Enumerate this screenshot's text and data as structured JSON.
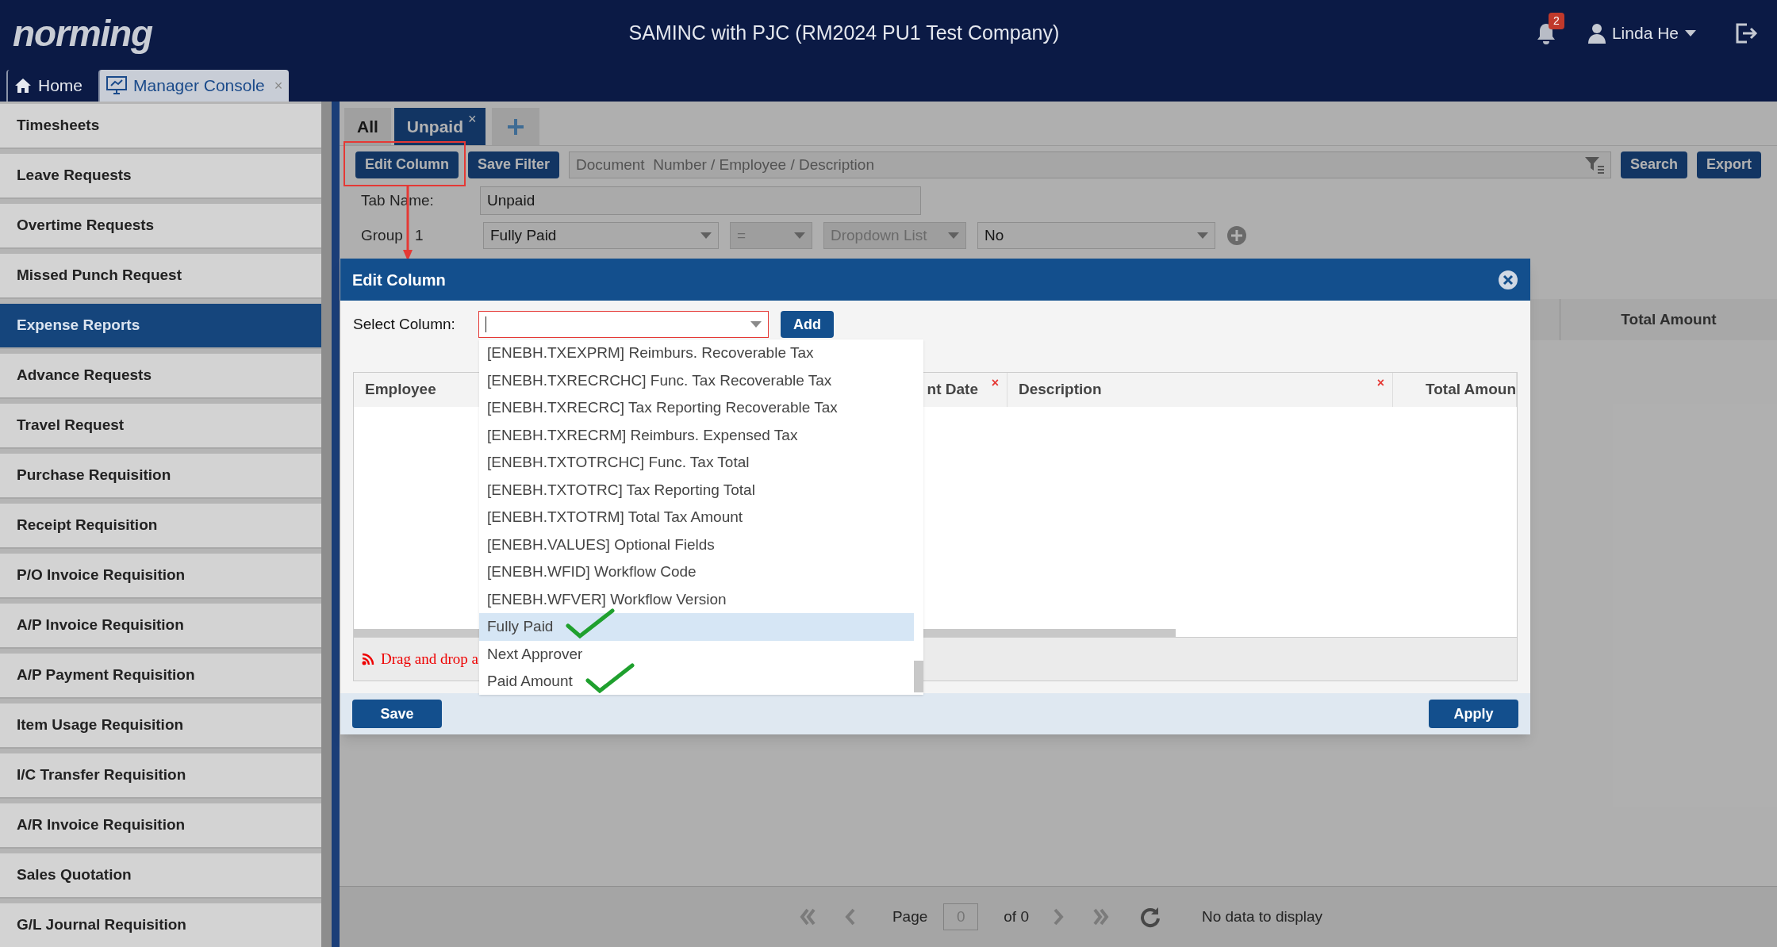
{
  "header": {
    "logo": "norming",
    "title": "SAMINC with PJC (RM2024 PU1 Test Company)",
    "notification_count": "2",
    "user": "Linda He"
  },
  "nav_tabs": [
    {
      "label": "Home",
      "selected": false
    },
    {
      "label": "Manager Console",
      "selected": true,
      "close": "×"
    }
  ],
  "sidebar": {
    "items": [
      {
        "label": "Timesheets",
        "selected": false
      },
      {
        "label": "Leave Requests",
        "selected": false
      },
      {
        "label": "Overtime Requests",
        "selected": false
      },
      {
        "label": "Missed Punch Request",
        "selected": false
      },
      {
        "label": "Expense Reports",
        "selected": true
      },
      {
        "label": "Advance Requests",
        "selected": false
      },
      {
        "label": "Travel Request",
        "selected": false
      },
      {
        "label": "Purchase Requisition",
        "selected": false
      },
      {
        "label": "Receipt Requisition",
        "selected": false
      },
      {
        "label": "P/O Invoice Requisition",
        "selected": false
      },
      {
        "label": "A/P Invoice Requisition",
        "selected": false
      },
      {
        "label": "A/P Payment Requisition",
        "selected": false
      },
      {
        "label": "Item Usage Requisition",
        "selected": false
      },
      {
        "label": "I/C Transfer Requisition",
        "selected": false
      },
      {
        "label": "A/R Invoice Requisition",
        "selected": false
      },
      {
        "label": "Sales Quotation",
        "selected": false
      },
      {
        "label": "G/L Journal Requisition",
        "selected": false
      }
    ]
  },
  "filter_tabs": [
    {
      "label": "All",
      "selected": false
    },
    {
      "label": "Unpaid",
      "selected": true,
      "close": "×"
    }
  ],
  "toolbar": {
    "edit_column": "Edit Column",
    "save_filter": "Save Filter",
    "search_placeholder": "Document  Number / Employee / Description",
    "search": "Search",
    "export": "Export"
  },
  "filter_form": {
    "tab_name_label": "Tab Name:",
    "tab_name": "Unpaid",
    "group_label": "Group 1",
    "field": "Fully Paid",
    "operator": "=",
    "operator_disabled": true,
    "type": "Dropdown List",
    "type_disabled": true,
    "value": "No"
  },
  "background_table": {
    "columns": [
      "Total Amount"
    ]
  },
  "dialog": {
    "title": "Edit Column",
    "select_label": "Select Column:",
    "add": "Add",
    "columns": [
      {
        "label": "Employee"
      },
      {
        "label": "nt Date",
        "remove": "×"
      },
      {
        "label": "Description",
        "remove": "×"
      },
      {
        "label": "Total Amoun"
      }
    ],
    "hint": "Drag and drop a",
    "save": "Save",
    "apply": "Apply"
  },
  "dropdown": {
    "items": [
      {
        "label": "[ENEBH.TXEXPRM] Reimburs. Recoverable Tax",
        "selected": false,
        "ticked": false
      },
      {
        "label": "[ENEBH.TXRECRCHC] Func. Tax Recoverable Tax",
        "selected": false,
        "ticked": false
      },
      {
        "label": "[ENEBH.TXRECRC] Tax Reporting Recoverable Tax",
        "selected": false,
        "ticked": false
      },
      {
        "label": "[ENEBH.TXRECRM] Reimburs. Expensed Tax",
        "selected": false,
        "ticked": false
      },
      {
        "label": "[ENEBH.TXTOTRCHC] Func. Tax Total",
        "selected": false,
        "ticked": false
      },
      {
        "label": "[ENEBH.TXTOTRC] Tax Reporting Total",
        "selected": false,
        "ticked": false
      },
      {
        "label": "[ENEBH.TXTOTRM] Total Tax Amount",
        "selected": false,
        "ticked": false
      },
      {
        "label": "[ENEBH.VALUES] Optional Fields",
        "selected": false,
        "ticked": false
      },
      {
        "label": "[ENEBH.WFID] Workflow Code",
        "selected": false,
        "ticked": false
      },
      {
        "label": "[ENEBH.WFVER] Workflow Version",
        "selected": false,
        "ticked": false
      },
      {
        "label": "Fully Paid",
        "selected": true,
        "ticked": true
      },
      {
        "label": "Next Approver",
        "selected": false,
        "ticked": false
      },
      {
        "label": "Paid Amount",
        "selected": false,
        "ticked": true
      }
    ]
  },
  "pager": {
    "page_label": "Page",
    "page": "0",
    "of": "of 0",
    "status": "No data to display"
  }
}
